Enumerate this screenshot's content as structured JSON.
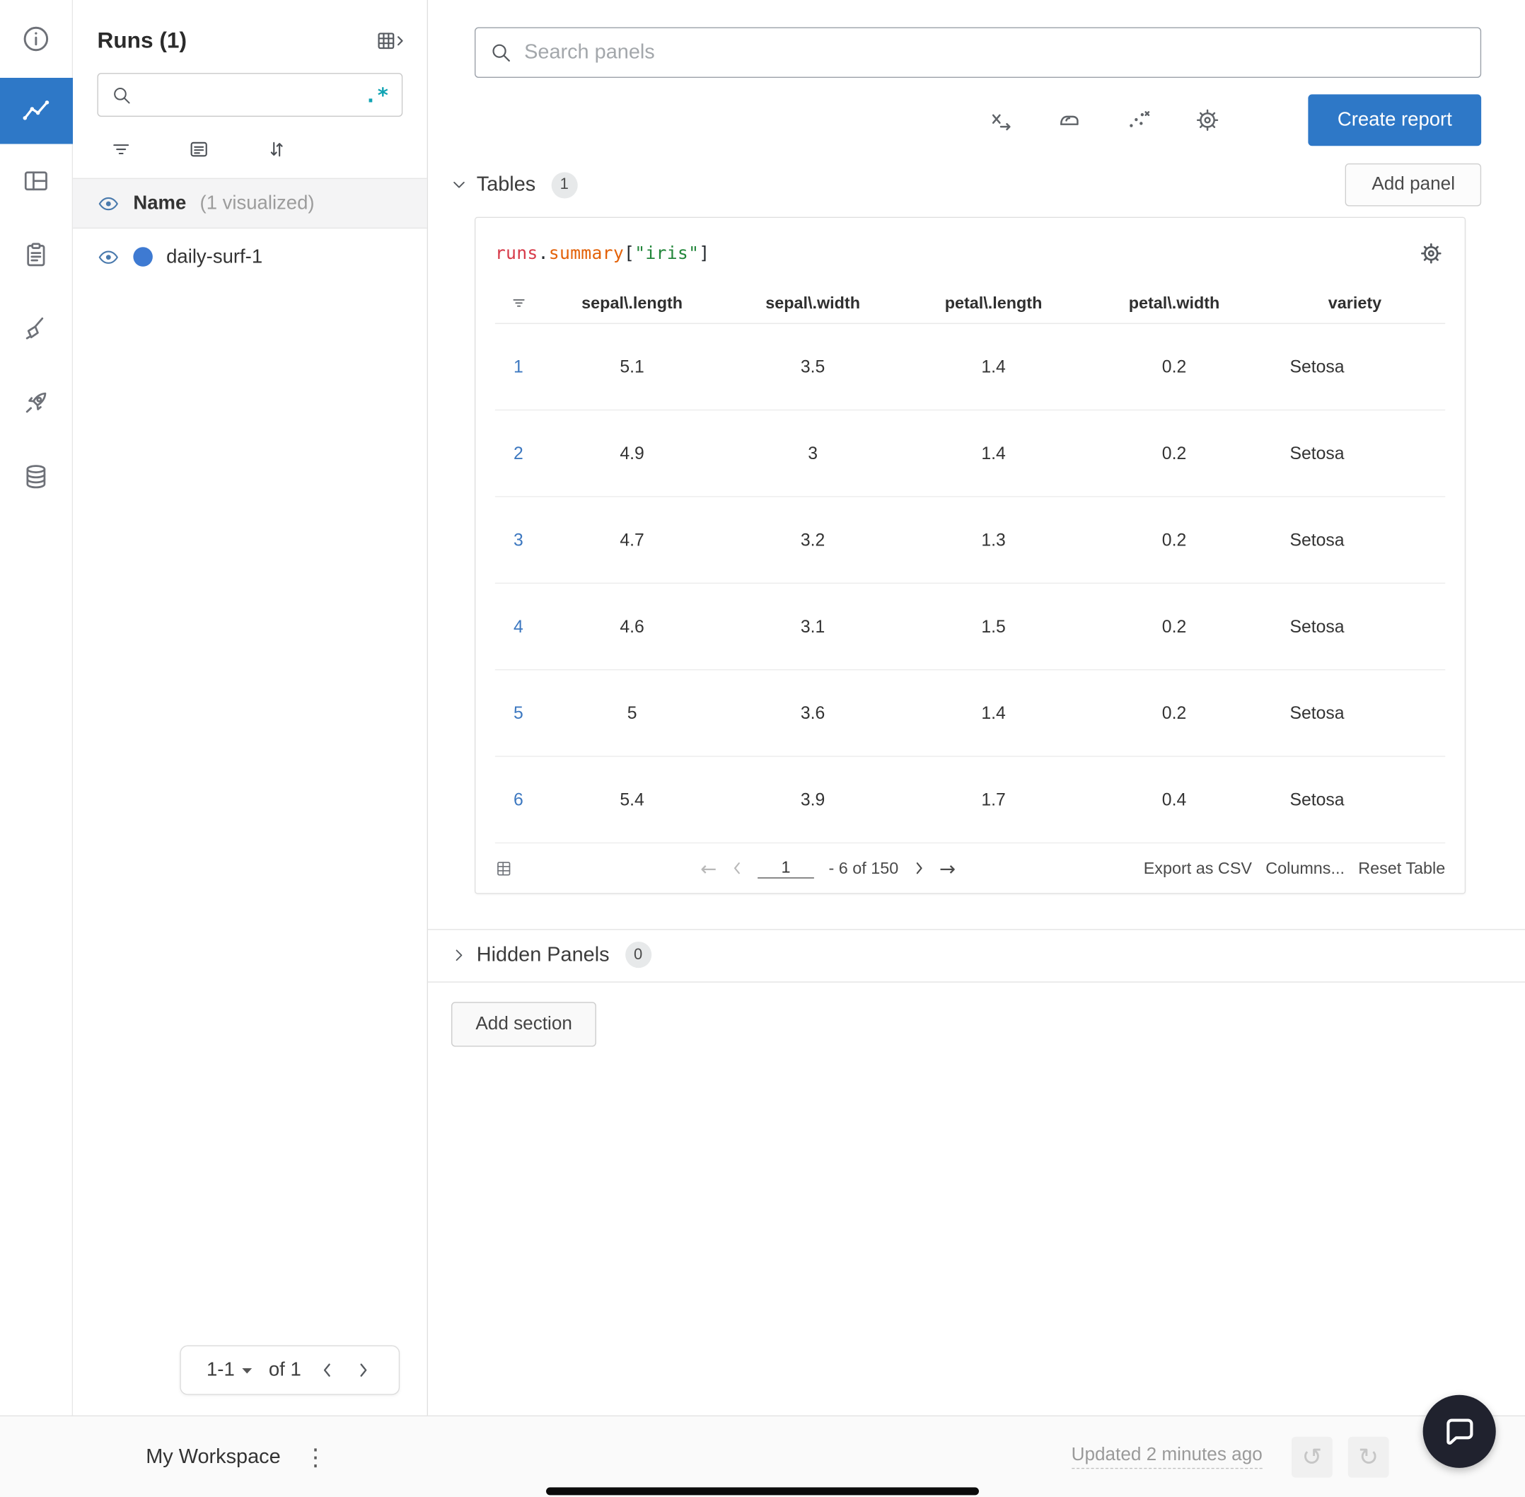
{
  "colors": {
    "primary_blue": "#2e78c7",
    "rail_selected_bg": "#2e78c7",
    "run_dot_blue": "#3e7ad2",
    "row_index_link": "#3d78c0",
    "regex_teal": "#12a4b4",
    "code_red": "#d73a49",
    "code_orange": "#e36209",
    "code_green": "#22863a",
    "chat_fab_bg": "#20222e"
  },
  "rail": {
    "items": [
      {
        "name": "info",
        "selected": false
      },
      {
        "name": "workspace-charts",
        "selected": true
      },
      {
        "name": "panels",
        "selected": false
      },
      {
        "name": "logs",
        "selected": false
      },
      {
        "name": "sweeps",
        "selected": false
      },
      {
        "name": "launch",
        "selected": false
      },
      {
        "name": "artifacts",
        "selected": false
      }
    ]
  },
  "sidebar": {
    "title": "Runs (1)",
    "search": {
      "value": "",
      "regex_label": ".*"
    },
    "header_row": {
      "name_label": "Name",
      "note": "(1 visualized)"
    },
    "runs": [
      {
        "label": "daily-surf-1"
      }
    ],
    "pagination": {
      "range_label": "1-1",
      "of_label": "of 1"
    }
  },
  "toolbar": {
    "search_placeholder": "Search panels",
    "create_report_label": "Create report"
  },
  "sections": {
    "tables": {
      "label": "Tables",
      "count": "1",
      "add_panel_label": "Add panel"
    },
    "hidden": {
      "label": "Hidden Panels",
      "count": "0"
    },
    "add_section_label": "Add section"
  },
  "panel": {
    "title_code": {
      "obj": "runs",
      "dot": ".",
      "prop": "summary",
      "bracket_open": "[",
      "key": "\"iris\"",
      "bracket_close": "]"
    },
    "table": {
      "columns": [
        "sepal\\.length",
        "sepal\\.width",
        "petal\\.length",
        "petal\\.width",
        "variety"
      ],
      "rows": [
        {
          "index": "1",
          "values": [
            "5.1",
            "3.5",
            "1.4",
            "0.2",
            "Setosa"
          ]
        },
        {
          "index": "2",
          "values": [
            "4.9",
            "3",
            "1.4",
            "0.2",
            "Setosa"
          ]
        },
        {
          "index": "3",
          "values": [
            "4.7",
            "3.2",
            "1.3",
            "0.2",
            "Setosa"
          ]
        },
        {
          "index": "4",
          "values": [
            "4.6",
            "3.1",
            "1.5",
            "0.2",
            "Setosa"
          ]
        },
        {
          "index": "5",
          "values": [
            "5",
            "3.6",
            "1.4",
            "0.2",
            "Setosa"
          ]
        },
        {
          "index": "6",
          "values": [
            "5.4",
            "3.9",
            "1.7",
            "0.4",
            "Setosa"
          ]
        }
      ]
    },
    "footer": {
      "page_value": "1",
      "range_label": "- 6 of 150",
      "export_label": "Export as CSV",
      "columns_label": "Columns...",
      "reset_label": "Reset Table"
    }
  },
  "statusbar": {
    "workspace_label": "My Workspace",
    "updated_label": "Updated 2 minutes ago"
  }
}
